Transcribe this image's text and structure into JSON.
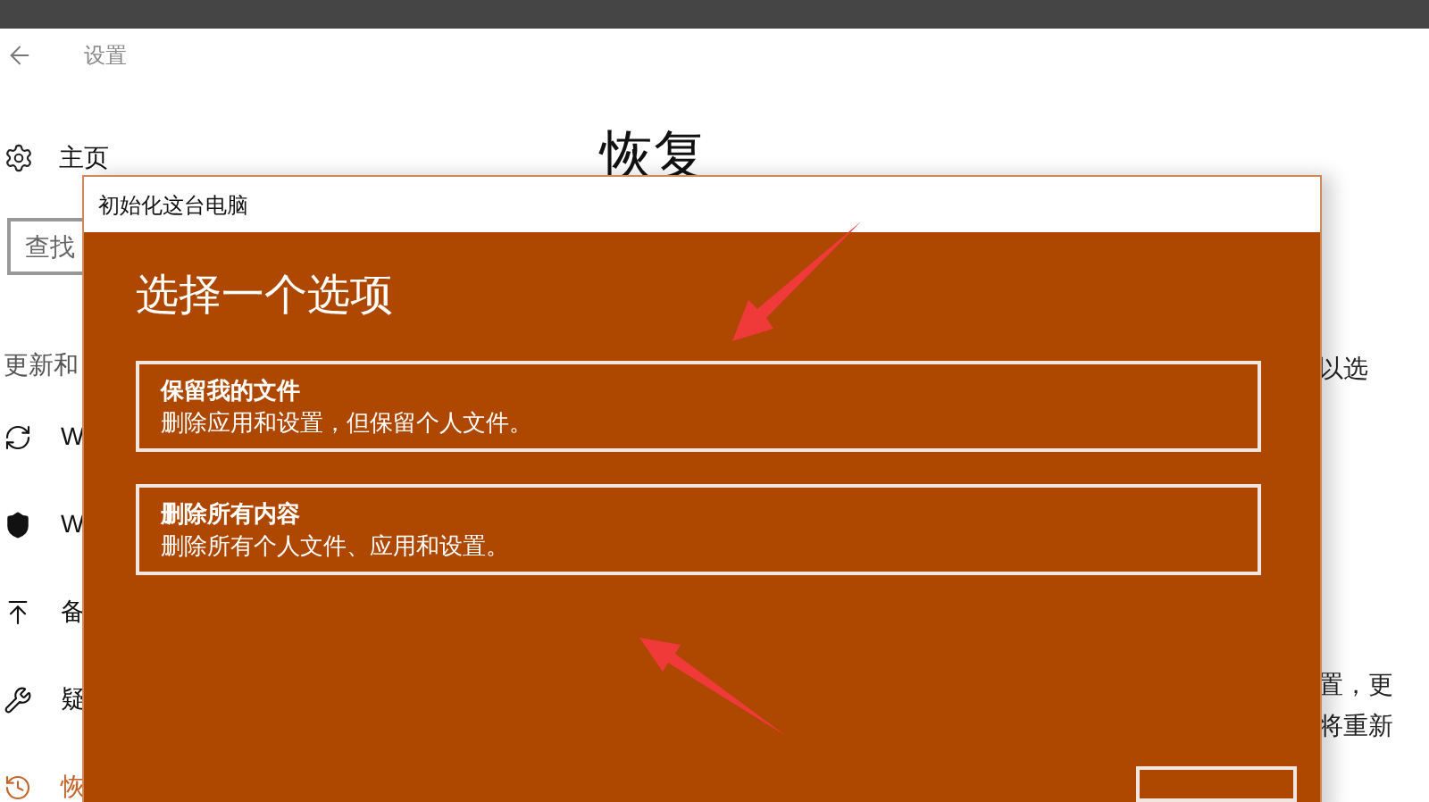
{
  "window": {
    "title": "设置"
  },
  "sidebar": {
    "home": "主页",
    "search": {
      "placeholder": "查找"
    },
    "section": "更新和",
    "items": [
      {
        "kind": "sync",
        "label": "W",
        "selected": false
      },
      {
        "kind": "shield",
        "label": "W",
        "selected": false
      },
      {
        "kind": "backup",
        "label": "备",
        "selected": false
      },
      {
        "kind": "wrench",
        "label": "疑",
        "selected": false
      },
      {
        "kind": "history",
        "label": "恢",
        "selected": true
      }
    ]
  },
  "page": {
    "title": "恢复",
    "side_texts": [
      "以选",
      "置，更",
      "将重新"
    ]
  },
  "dialog": {
    "title": "初始化这台电脑",
    "heading": "选择一个选项",
    "options": [
      {
        "title": "保留我的文件",
        "description": "删除应用和设置，但保留个人文件。"
      },
      {
        "title": "删除所有内容",
        "description": "删除所有个人文件、应用和设置。"
      }
    ]
  }
}
